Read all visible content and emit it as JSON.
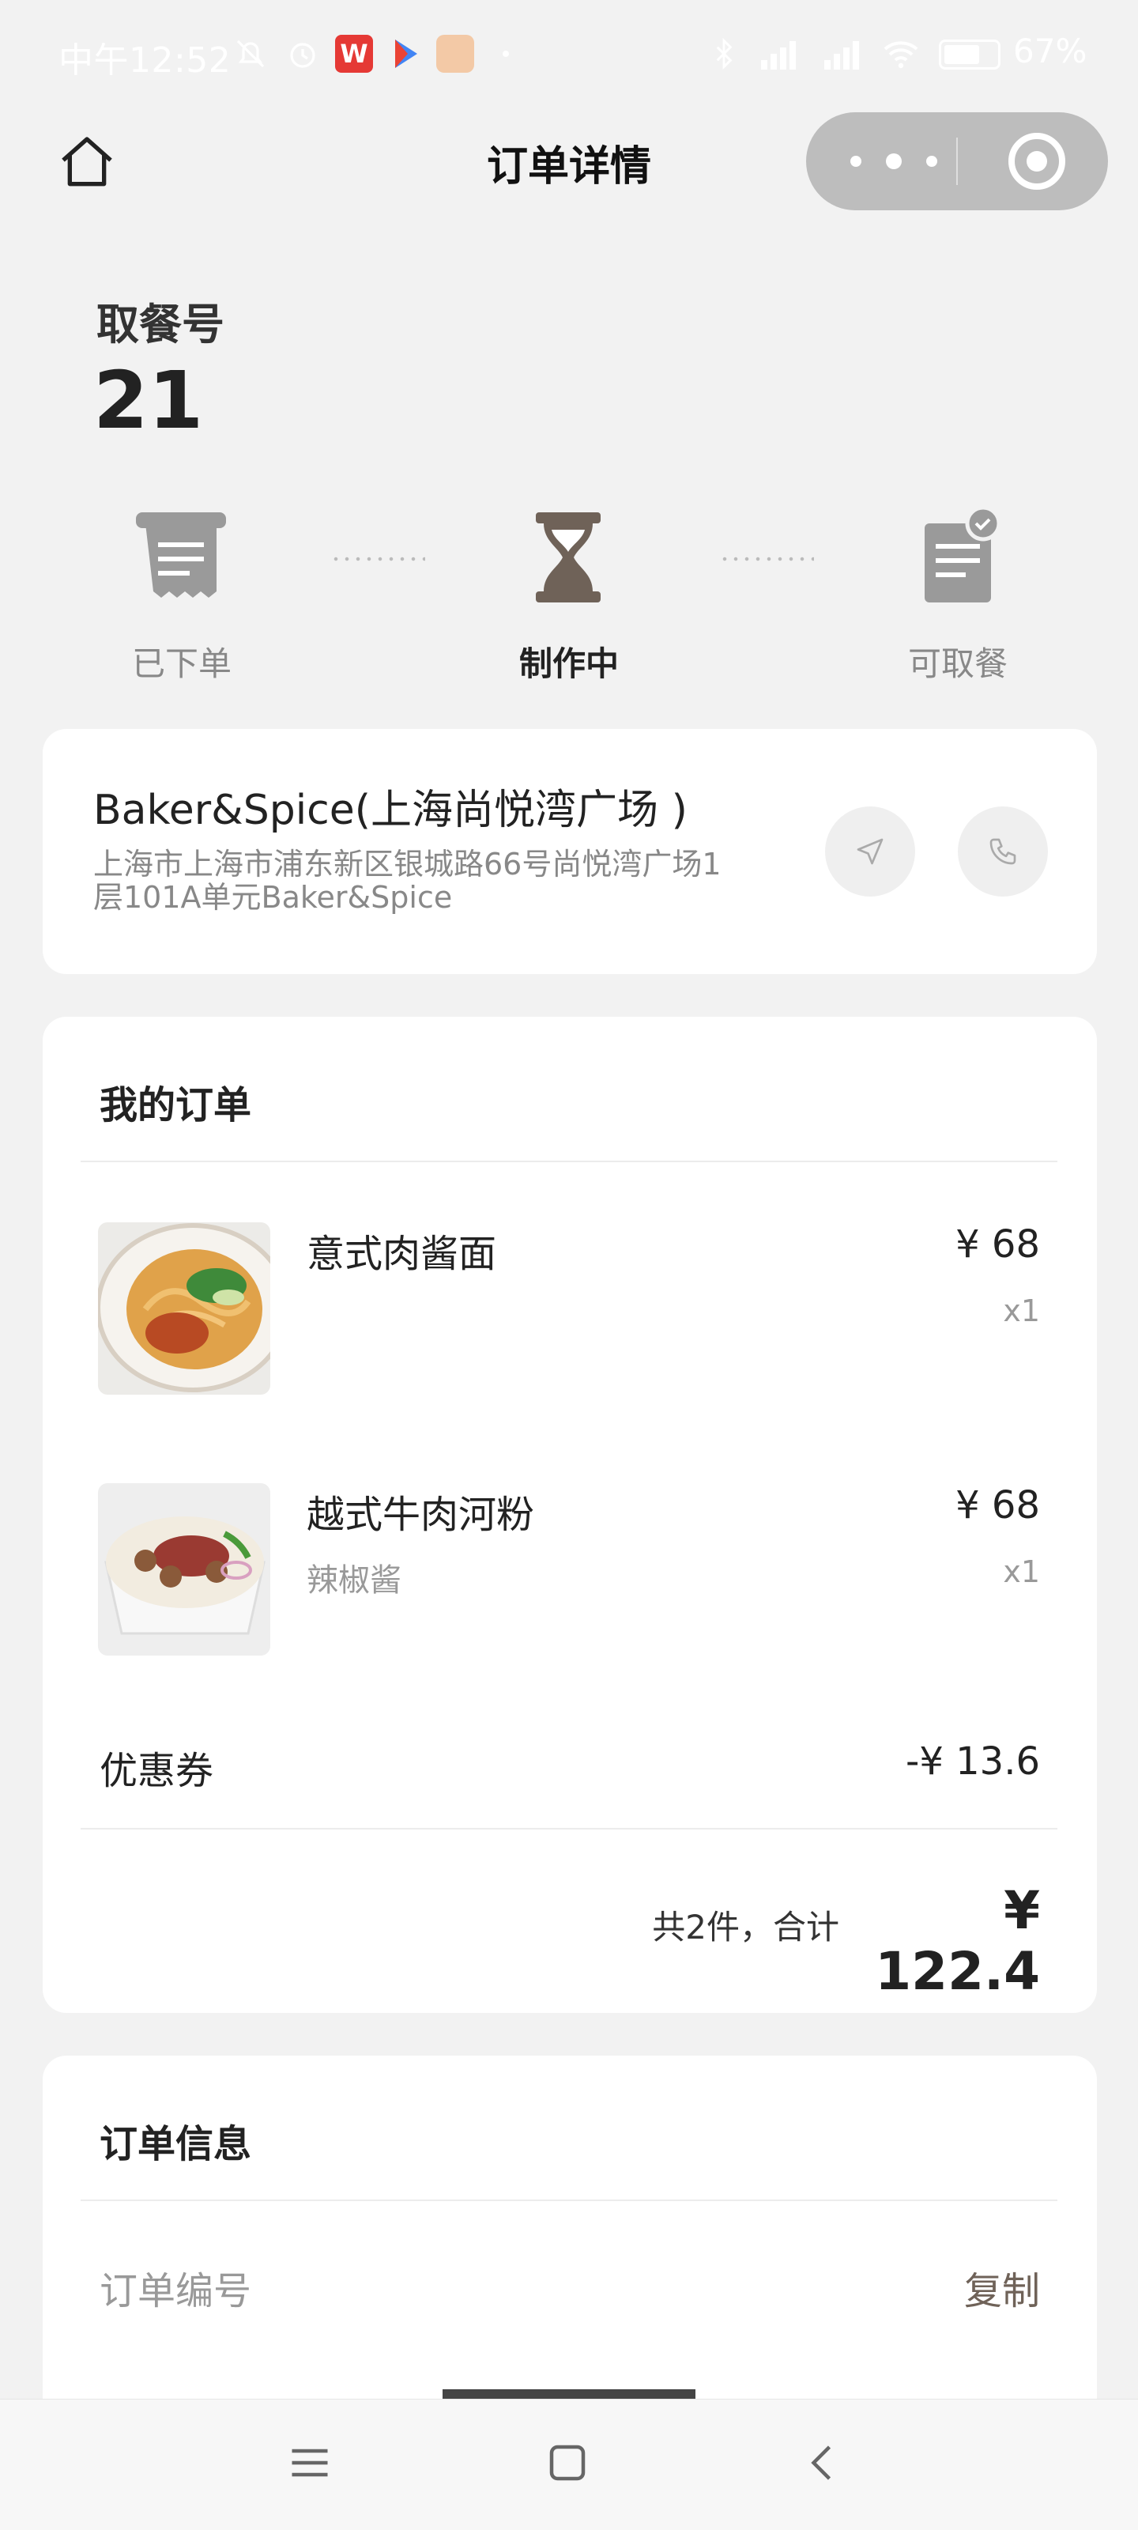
{
  "status_bar": {
    "time": "中午12:52",
    "battery": "67%",
    "app_icons": [
      "wps-icon",
      "play-store-icon",
      "cat-app-icon"
    ]
  },
  "header": {
    "title": "订单详情",
    "home_icon": "home-icon",
    "more_icon": "more-dots-icon",
    "close_icon": "target-icon"
  },
  "pickup": {
    "label": "取餐号",
    "number": "21"
  },
  "progress": {
    "steps": [
      {
        "label": "已下单",
        "active": false,
        "icon": "receipt-icon"
      },
      {
        "label": "制作中",
        "active": true,
        "icon": "hourglass-icon"
      },
      {
        "label": "可取餐",
        "active": false,
        "icon": "ready-document-icon"
      }
    ]
  },
  "store": {
    "name": "Baker&Spice(上海尚悦湾广场 )",
    "address_line1": "上海市上海市浦东新区银城路66号尚悦湾广场1",
    "address_line2": "层101A单元Baker&Spice"
  },
  "order": {
    "title": "我的订单",
    "items": [
      {
        "name": "意式肉酱面",
        "note": "",
        "price": "¥ 68",
        "qty": "x1"
      },
      {
        "name": "越式牛肉河粉",
        "note": "辣椒酱",
        "price": "¥ 68",
        "qty": "x1"
      }
    ],
    "coupon_label": "优惠券",
    "coupon_value": "-¥ 13.6",
    "total_label": "共2件，合计",
    "total_value": "¥ 122.4"
  },
  "order_info": {
    "title": "订单信息",
    "order_no_label": "订单编号",
    "copy_label": "复制"
  },
  "colors": {
    "accent_brown": "#6f6258",
    "icon_grey": "#9a9a9a",
    "capsule_grey": "#bdbdbd"
  }
}
